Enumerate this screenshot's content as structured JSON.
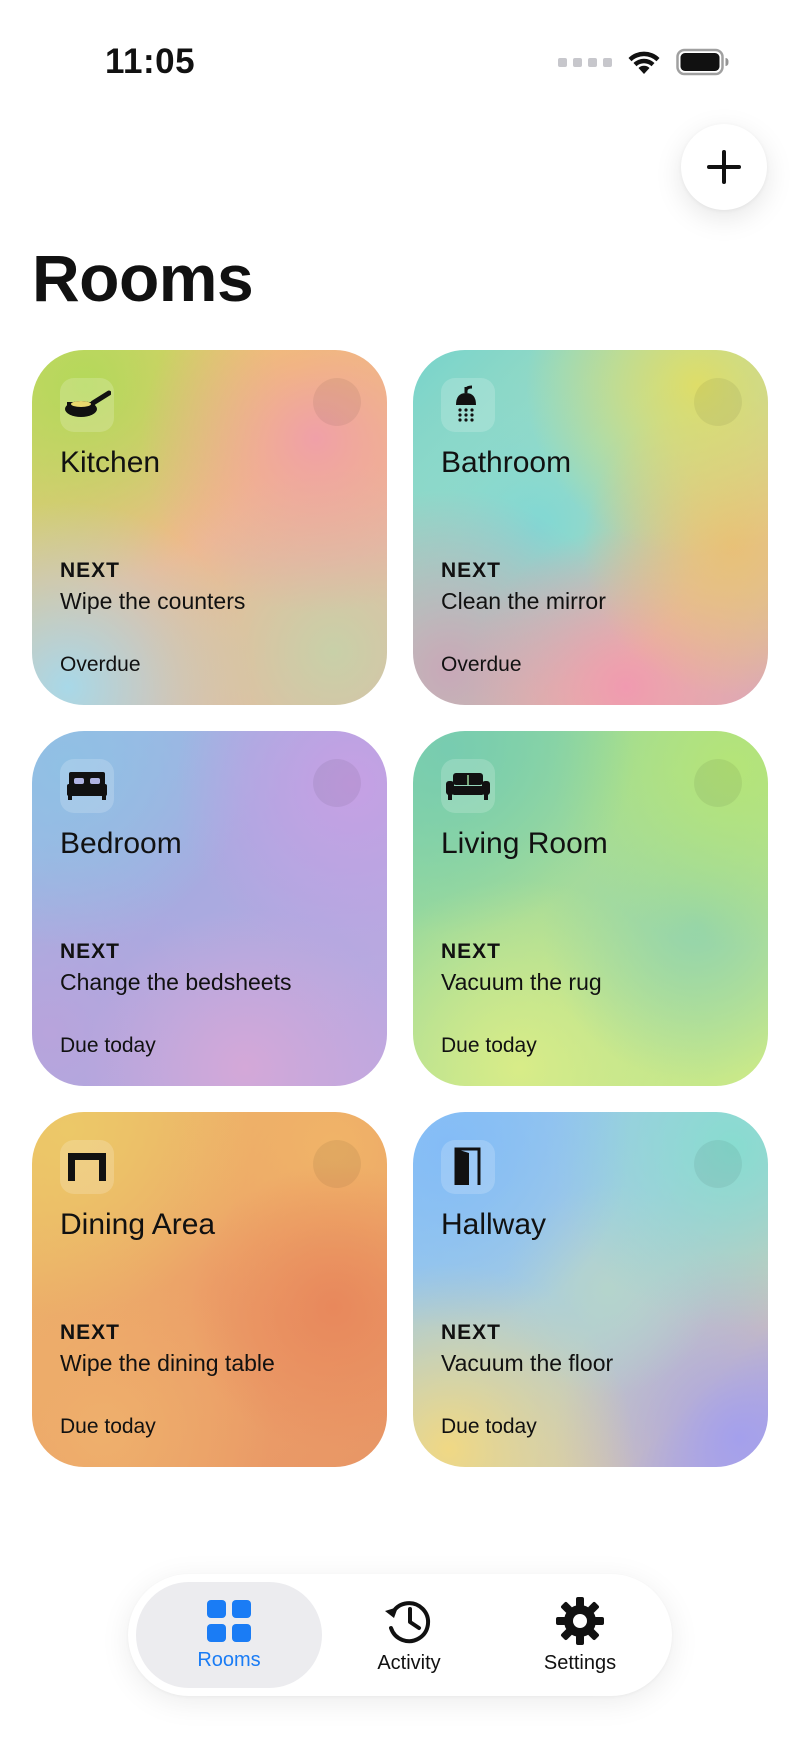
{
  "status_bar": {
    "time": "11:05"
  },
  "header": {
    "title": "Rooms",
    "add_button_icon": "plus-icon"
  },
  "rooms": [
    {
      "name": "Kitchen",
      "icon": "frying-pan-icon",
      "next_label": "NEXT",
      "task": "Wipe the counters",
      "status": "Overdue"
    },
    {
      "name": "Bathroom",
      "icon": "shower-icon",
      "next_label": "NEXT",
      "task": "Clean the mirror",
      "status": "Overdue"
    },
    {
      "name": "Bedroom",
      "icon": "bed-icon",
      "next_label": "NEXT",
      "task": "Change the bedsheets",
      "status": "Due today"
    },
    {
      "name": "Living Room",
      "icon": "sofa-icon",
      "next_label": "NEXT",
      "task": "Vacuum the rug",
      "status": "Due today"
    },
    {
      "name": "Dining Area",
      "icon": "table-icon",
      "next_label": "NEXT",
      "task": "Wipe the dining table",
      "status": "Due today"
    },
    {
      "name": "Hallway",
      "icon": "door-icon",
      "next_label": "NEXT",
      "task": "Vacuum the floor",
      "status": "Due today"
    }
  ],
  "tabs": [
    {
      "label": "Rooms",
      "icon": "grid-icon",
      "active": true
    },
    {
      "label": "Activity",
      "icon": "history-clock-icon",
      "active": false
    },
    {
      "label": "Settings",
      "icon": "gear-icon",
      "active": false
    }
  ],
  "colors": {
    "accent": "#1a7cf5"
  }
}
